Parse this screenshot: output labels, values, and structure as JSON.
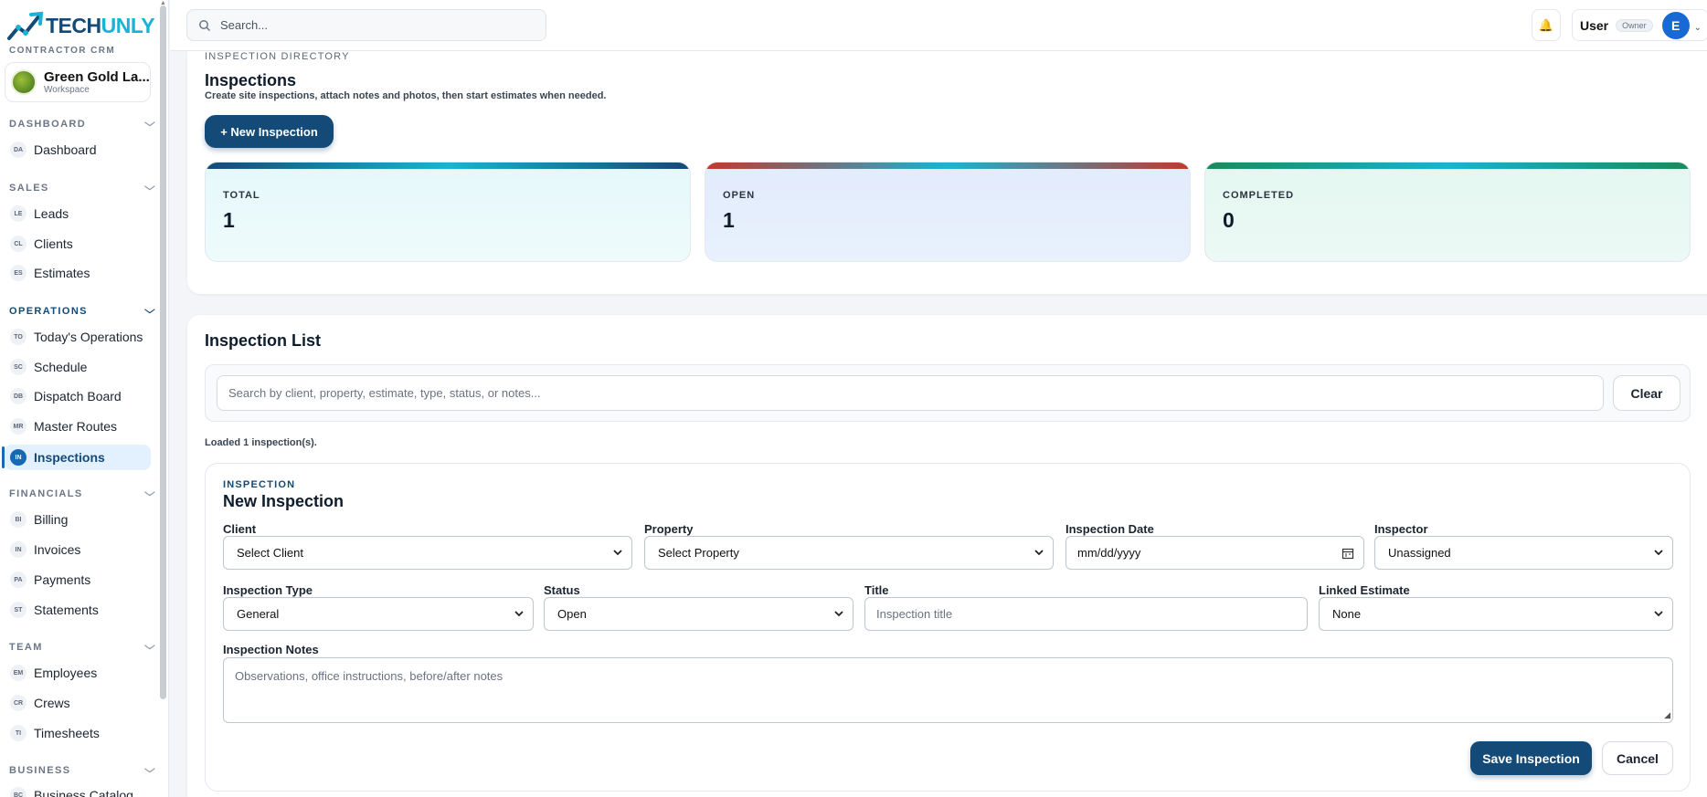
{
  "brand": {
    "name_part1": "TECH",
    "name_part2": "UNLY",
    "subtitle": "CONTRACTOR CRM"
  },
  "workspace": {
    "name": "Green Gold La...",
    "label": "Workspace"
  },
  "sidebar": {
    "sections": [
      {
        "title": "DASHBOARD",
        "items": [
          {
            "abbr": "DA",
            "label": "Dashboard"
          }
        ]
      },
      {
        "title": "SALES",
        "items": [
          {
            "abbr": "LE",
            "label": "Leads"
          },
          {
            "abbr": "CL",
            "label": "Clients"
          },
          {
            "abbr": "ES",
            "label": "Estimates"
          }
        ]
      },
      {
        "title": "OPERATIONS",
        "items": [
          {
            "abbr": "TO",
            "label": "Today's Operations"
          },
          {
            "abbr": "SC",
            "label": "Schedule"
          },
          {
            "abbr": "DB",
            "label": "Dispatch Board"
          },
          {
            "abbr": "MR",
            "label": "Master Routes"
          },
          {
            "abbr": "IN",
            "label": "Inspections"
          }
        ]
      },
      {
        "title": "FINANCIALS",
        "items": [
          {
            "abbr": "BI",
            "label": "Billing"
          },
          {
            "abbr": "IN",
            "label": "Invoices"
          },
          {
            "abbr": "PA",
            "label": "Payments"
          },
          {
            "abbr": "ST",
            "label": "Statements"
          }
        ]
      },
      {
        "title": "TEAM",
        "items": [
          {
            "abbr": "EM",
            "label": "Employees"
          },
          {
            "abbr": "CR",
            "label": "Crews"
          },
          {
            "abbr": "TI",
            "label": "Timesheets"
          }
        ]
      },
      {
        "title": "BUSINESS",
        "items": [
          {
            "abbr": "BC",
            "label": "Business Catalog"
          }
        ]
      }
    ]
  },
  "topbar": {
    "search_placeholder": "Search...",
    "user_name": "User",
    "user_role": "Owner",
    "user_initial": "E"
  },
  "directory": {
    "eyebrow": "INSPECTION DIRECTORY",
    "title": "Inspections",
    "subtitle": "Create site inspections, attach notes and photos, then start estimates when needed.",
    "new_button": "+ New Inspection"
  },
  "stats": [
    {
      "label": "TOTAL",
      "value": "1",
      "accent": "#134a77"
    },
    {
      "label": "OPEN",
      "value": "1",
      "accent": "#c0392b"
    },
    {
      "label": "COMPLETED",
      "value": "0",
      "accent": "#1a8a5a"
    }
  ],
  "list": {
    "title": "Inspection List",
    "search_placeholder": "Search by client, property, estimate, type, status, or notes...",
    "clear_button": "Clear",
    "loaded_text": "Loaded 1 inspection(s)."
  },
  "form": {
    "eyebrow": "INSPECTION",
    "title": "New Inspection",
    "client_label": "Client",
    "client_value": "Select Client",
    "property_label": "Property",
    "property_value": "Select Property",
    "date_label": "Inspection Date",
    "date_placeholder": "mm/dd/yyyy",
    "inspector_label": "Inspector",
    "inspector_value": "Unassigned",
    "type_label": "Inspection Type",
    "type_value": "General",
    "status_label": "Status",
    "status_value": "Open",
    "title_label": "Title",
    "title_placeholder": "Inspection title",
    "estimate_label": "Linked Estimate",
    "estimate_value": "None",
    "notes_label": "Inspection Notes",
    "notes_placeholder": "Observations, office instructions, before/after notes",
    "save_button": "Save Inspection",
    "cancel_button": "Cancel"
  }
}
